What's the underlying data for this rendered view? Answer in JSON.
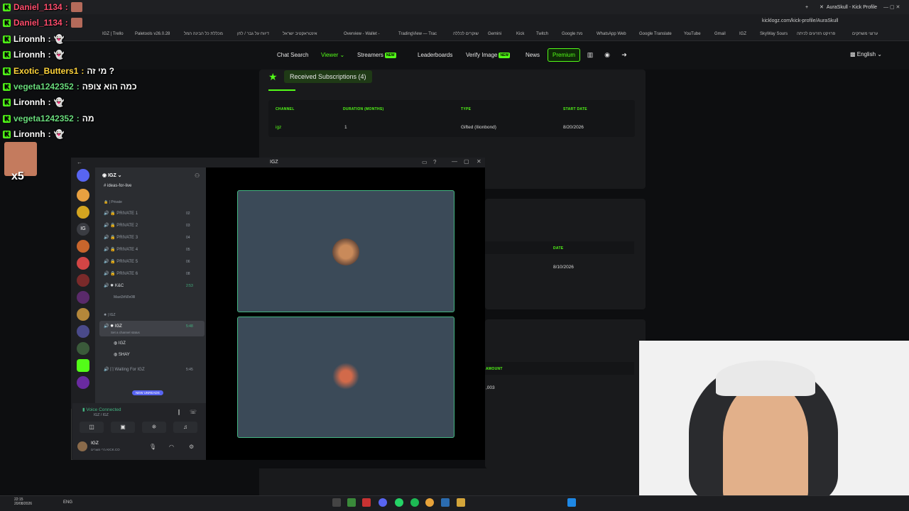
{
  "browser": {
    "tab_title": "AuraSkull - Kick Profile",
    "url": "kicklogz.com/kick-profile/AuraSkull",
    "bookmarks": [
      "IGZ | Trello",
      "Paletools v26.0.28",
      "מכללת כל הבינה המל",
      "דיווח על גבר / לחן",
      "אינטראקטיב ישראל",
      "Overview - Wallet -",
      "TradingView — Trac",
      "שוקרים לכללה",
      "Gemini",
      "Kick",
      "Twitch",
      "Google מת",
      "WhatsApp Web",
      "Google Translate",
      "YouTube",
      "Gmail",
      "IGZ",
      "SkyWay Sours",
      "פרויקט הזרעים לכיתה",
      "ערוצי משחקים"
    ]
  },
  "site_nav": {
    "chat_search": "Chat Search",
    "viewer": "Viewer",
    "streamers": "Streamers",
    "leaderboards": "Leaderboards",
    "verify_image": "Verify Image",
    "news": "News",
    "premium": "Premium",
    "new_badge": "NEW",
    "language": "English"
  },
  "subscriptions": {
    "title": "Received Subscriptions (4)",
    "headers": [
      "CHANNEL",
      "DURATION (MONTHS)",
      "TYPE",
      "START DATE"
    ],
    "rows": [
      [
        "igz",
        "1",
        "Gifted (Ilionbond)",
        "8/20/2026"
      ]
    ]
  },
  "second_table": {
    "header_date": "DATE",
    "date_value": "8/10/2026",
    "header_amount": "AMOUNT",
    "amount_value": ",003"
  },
  "chat": [
    {
      "user": "Daniel_1134",
      "message": "",
      "color": "#ff4d6d"
    },
    {
      "user": "Daniel_1134",
      "message": "",
      "color": "#ff4d6d"
    },
    {
      "user": "Lironnh",
      "message": "",
      "color": "#ffffff"
    },
    {
      "user": "Lironnh",
      "message": "",
      "color": "#ffffff"
    },
    {
      "user": "Exotic_Butters1",
      "message": "מי זה ?",
      "color": "#ffd43b"
    },
    {
      "user": "vegeta1242352",
      "message": "כמה הוא צופה",
      "color": "#69db7c"
    },
    {
      "user": "Lironnh",
      "message": "",
      "color": "#ffffff"
    },
    {
      "user": "vegeta1242352",
      "message": "מה",
      "color": "#69db7c"
    },
    {
      "user": "Lironnh",
      "message": "",
      "color": "#ffffff"
    }
  ],
  "chat_overlay_x5": "x5",
  "discord": {
    "window_title": "IGZ",
    "server_name": "IGZ",
    "channel_top": "ideas-for-live",
    "category_private": "Private",
    "private_channels": [
      {
        "name": "PRIVATE 1",
        "count": "02"
      },
      {
        "name": "PRIVATE 2",
        "count": "03"
      },
      {
        "name": "PRIVATE 3",
        "count": "04"
      },
      {
        "name": "PRIVATE 4",
        "count": "05"
      },
      {
        "name": "PRIVATE 5",
        "count": "06"
      },
      {
        "name": "PRIVATE 6",
        "count": "08"
      }
    ],
    "kc_channel": "K&C",
    "kc_time": "2:53",
    "kc_member": "Mast3rN0v0lll",
    "category_igz": "IGZ",
    "igz_channel": "IGZ",
    "igz_time": "5:48",
    "igz_status": "Set a channel status",
    "members": [
      "IGZ",
      "SHAY"
    ],
    "waiting_channel": "Waiting For IGZ",
    "waiting_time": "5:45",
    "new_unreads": "NEW UNREADS",
    "voice_connected": "Voice Connected",
    "voice_sub": "IGZ / IGZ",
    "user_name": "IGZ",
    "user_status": "ג'רי מוצרים KICK.CO"
  },
  "taskbar": {
    "time": "22:15",
    "date": "20/08/2026",
    "lang": "ENG"
  },
  "colors": {
    "kick_green": "#53fc18",
    "discord_bg": "#1e1f22",
    "tile_border": "#43b581"
  }
}
